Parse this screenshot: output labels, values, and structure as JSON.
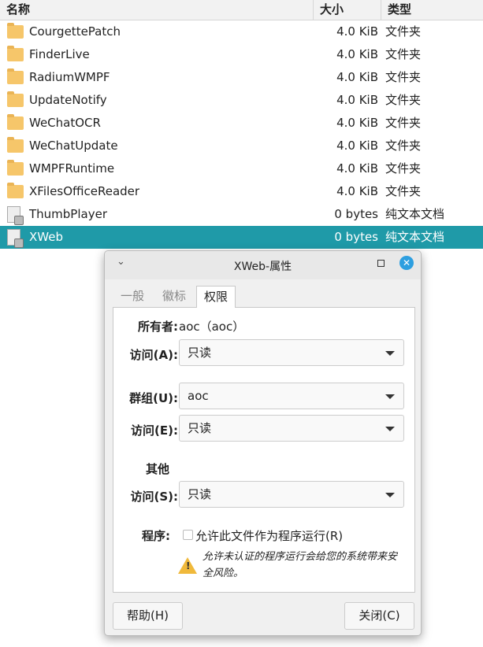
{
  "columns": {
    "name": "名称",
    "size": "大小",
    "type": "类型"
  },
  "files": [
    {
      "name": "CourgettePatch",
      "size": "4.0 KiB",
      "type": "文件夹",
      "icon": "folder-icon"
    },
    {
      "name": "FinderLive",
      "size": "4.0 KiB",
      "type": "文件夹",
      "icon": "folder-icon"
    },
    {
      "name": "RadiumWMPF",
      "size": "4.0 KiB",
      "type": "文件夹",
      "icon": "folder-icon"
    },
    {
      "name": "UpdateNotify",
      "size": "4.0 KiB",
      "type": "文件夹",
      "icon": "folder-icon"
    },
    {
      "name": "WeChatOCR",
      "size": "4.0 KiB",
      "type": "文件夹",
      "icon": "folder-icon"
    },
    {
      "name": "WeChatUpdate",
      "size": "4.0 KiB",
      "type": "文件夹",
      "icon": "folder-icon"
    },
    {
      "name": "WMPFRuntime",
      "size": "4.0 KiB",
      "type": "文件夹",
      "icon": "folder-icon"
    },
    {
      "name": "XFilesOfficeReader",
      "size": "4.0 KiB",
      "type": "文件夹",
      "icon": "folder-icon"
    },
    {
      "name": "ThumbPlayer",
      "size": "0 bytes",
      "type": "纯文本文档",
      "icon": "text-file-locked-icon"
    },
    {
      "name": "XWeb",
      "size": "0 bytes",
      "type": "纯文本文档",
      "icon": "text-file-locked-icon",
      "selected": true
    }
  ],
  "dialog": {
    "title": "XWeb-属性",
    "tabs": [
      "一般",
      "徽标",
      "权限"
    ],
    "owner_label": "所有者:",
    "owner_value": "aoc（aoc）",
    "owner_access_label": "访问(A):",
    "owner_access": "只读",
    "group_label": "群组(U):",
    "group": "aoc",
    "group_access_label": "访问(E):",
    "group_access": "只读",
    "others_label": "其他",
    "others_access_label": "访问(S):",
    "others_access": "只读",
    "program_label": "程序:",
    "exec_checkbox": "允许此文件作为程序运行(R)",
    "exec_checked": false,
    "warning": "允许未认证的程序运行会给您的系统带来安全风险。",
    "help_button": "帮助(H)",
    "close_button": "关闭(C)"
  },
  "colors": {
    "selection": "#1f9aa8",
    "close": "#2d9fe0"
  }
}
